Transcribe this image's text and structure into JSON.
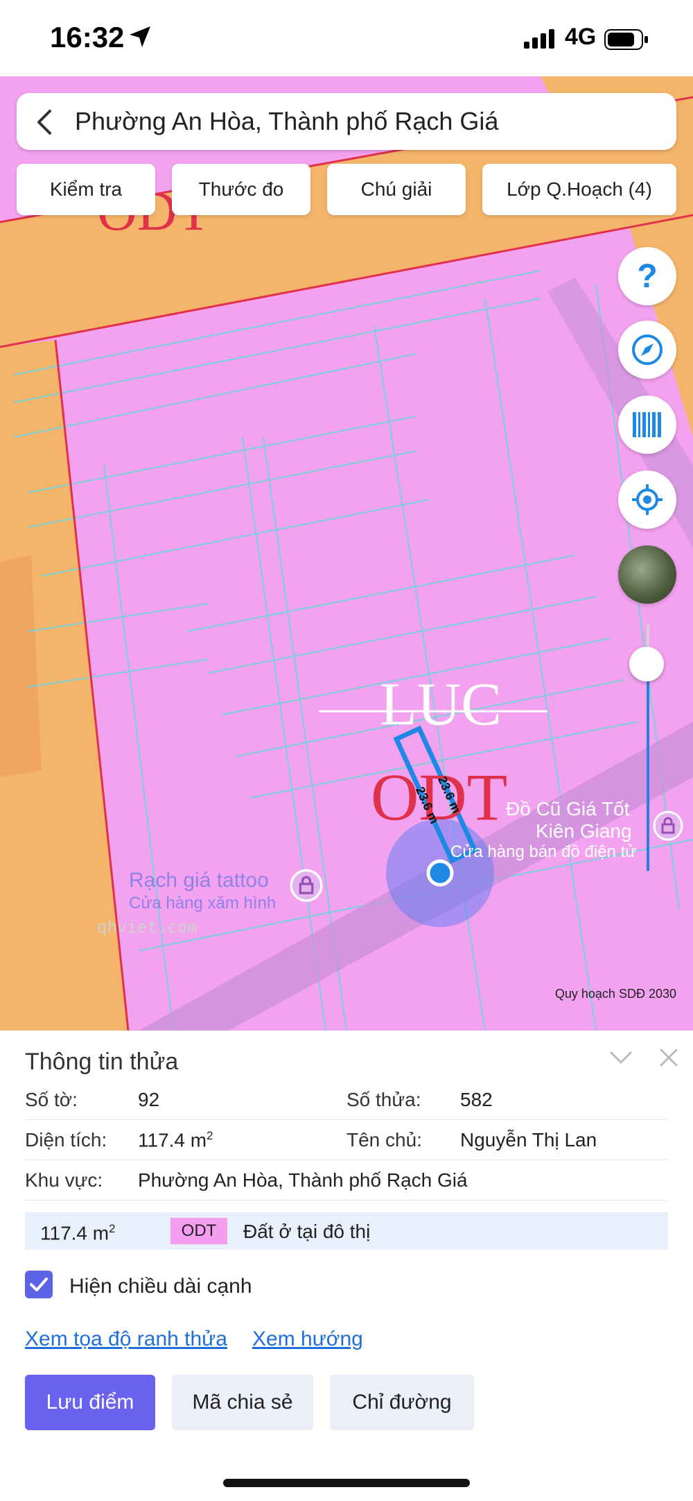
{
  "status_bar": {
    "time": "16:32",
    "network": "4G"
  },
  "search": {
    "title": "Phường An Hòa, Thành phố Rạch Giá"
  },
  "toolbar": {
    "check": "Kiểm tra",
    "measure": "Thước đo",
    "legend": "Chú giải",
    "layers": "Lớp Q.Hoạch (4)"
  },
  "map": {
    "zone_odt_top": "ODT",
    "zone_luc": "LUC",
    "zone_odt": "ODT",
    "edge_1": "23.6 m",
    "edge_2": "23.6 m",
    "poi_1_name": "Đồ Cũ Giá Tốt",
    "poi_1_name2": "Kiên Giang",
    "poi_1_sub": "Cửa hàng bán đồ điện tử",
    "poi_2_name": "Rạch giá tattoo",
    "poi_2_sub": "Cửa hàng xăm hình",
    "watermark": "qhviet.com",
    "credit": "Quy hoạch SDĐ 2030",
    "colors": {
      "residential": "#f3a2f0",
      "road": "#f4b56a",
      "selection": "#1e88e5"
    }
  },
  "parcel": {
    "heading": "Thông tin thửa",
    "sheet_label": "Số tờ:",
    "sheet_value": "92",
    "plot_label": "Số thửa:",
    "plot_value": "582",
    "area_label": "Diện tích:",
    "area_value": "117.4 m",
    "area_unit_sup": "2",
    "owner_label": "Tên chủ:",
    "owner_value": "Nguyễn Thị Lan",
    "region_label": "Khu vực:",
    "region_value": "Phường An Hòa, Thành phố Rạch Giá",
    "land_area": "117.4 m",
    "land_area_sup": "2",
    "land_code": "ODT",
    "land_desc": "Đất ở tại đô thị",
    "show_edges_label": "Hiện chiều dài cạnh",
    "show_edges_checked": true,
    "link_coords": "Xem tọa độ ranh thửa",
    "link_direction": "Xem hướng",
    "btn_save": "Lưu điểm",
    "btn_share": "Mã chia sẻ",
    "btn_directions": "Chỉ đường"
  }
}
